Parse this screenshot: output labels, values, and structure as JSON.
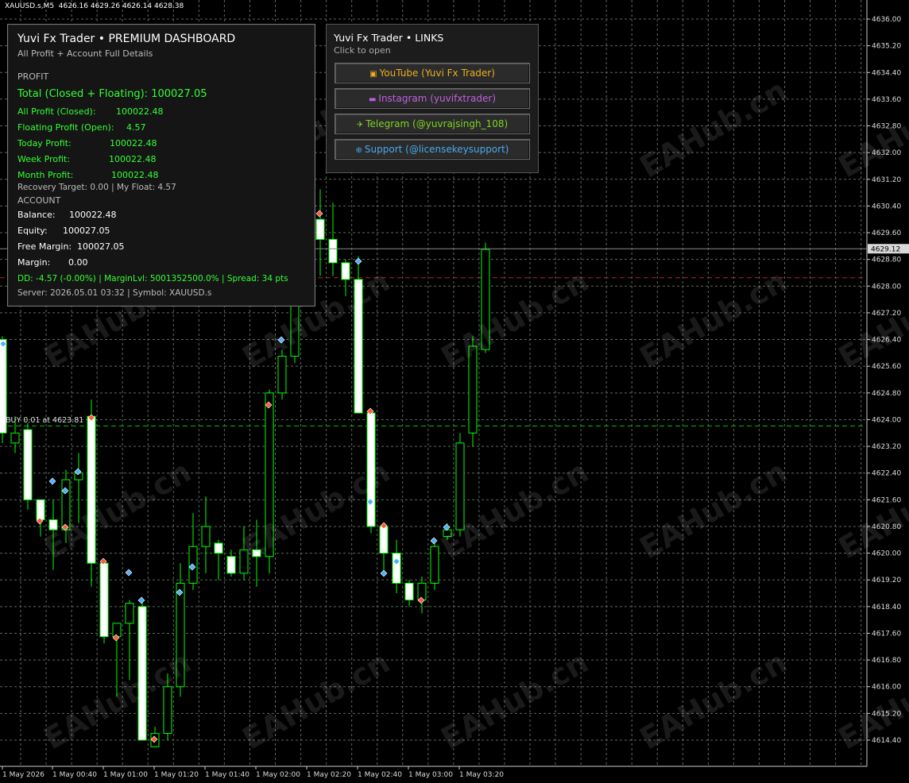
{
  "chart_header": {
    "symbol": "XAUUSD.s,M5",
    "ohlc": "4626.16 4629.26 4626.14 4628.38"
  },
  "dashboard": {
    "title": "Yuvi Fx Trader • PREMIUM DASHBOARD",
    "subtitle": "All Profit + Account Full Details",
    "profit_section": "PROFIT",
    "total_label": "Total (Closed + Floating):",
    "total_value": "100027.05",
    "rows": [
      {
        "label": "All Profit (Closed):",
        "value": "100022.48"
      },
      {
        "label": "Floating Profit (Open):",
        "value": "4.57"
      },
      {
        "label": "Today Profit:",
        "value": "100022.48"
      },
      {
        "label": "Week Profit:",
        "value": "100022.48"
      },
      {
        "label": "Month Profit:",
        "value": "100022.48"
      }
    ],
    "recovery_line": "Recovery Target: 0.00 | My Float: 4.57",
    "account_section": "ACCOUNT",
    "account_rows": [
      {
        "label": "Balance:",
        "value": "100022.48"
      },
      {
        "label": "Equity:",
        "value": "100027.05"
      },
      {
        "label": "Free Margin:",
        "value": "100027.05"
      },
      {
        "label": "Margin:",
        "value": "0.00"
      }
    ],
    "dd_line": "DD: -4.57 (-0.00%) | MarginLvl: 5001352500.0% | Spread: 34 pts",
    "server_line": "Server: 2026.05.01 03:32 | Symbol: XAUUSD.s"
  },
  "links_panel": {
    "title": "Yuvi Fx Trader • LINKS",
    "subtitle": "Click to open",
    "buttons": [
      {
        "icon": "▣",
        "label": "YouTube  (Yuvi Fx Trader)",
        "color": "#e8b020"
      },
      {
        "icon": "▬",
        "label": "Instagram (yuvifxtrader)",
        "color": "#c060e0"
      },
      {
        "icon": "✈",
        "label": "Telegram  (@yuvrajsingh_108)",
        "color": "#7ed321"
      },
      {
        "icon": "⊕",
        "label": "Support  (@licensekeysupport)",
        "color": "#4aa8e8"
      }
    ]
  },
  "buy_label": "BUY 0.01 at 4623.81",
  "current_price": "4629.12",
  "watermark": "EAHub.cn",
  "colors": {
    "background": "#000000",
    "grid": "#5a6a5a",
    "candle_bull_fill": "#000000",
    "candle_bear_fill": "#ffffff",
    "candle_outline": "#00ff00",
    "profit_green": "#33ff33",
    "buy_line": "#00c000",
    "ask_line": "#c02020"
  },
  "chart_data": {
    "type": "candlestick",
    "y_axis_ticks": [
      "4636.00",
      "4635.20",
      "4634.40",
      "4633.60",
      "4632.80",
      "4632.00",
      "4631.20",
      "4630.40",
      "4629.60",
      "4628.80",
      "4628.00",
      "4627.20",
      "4626.40",
      "4625.60",
      "4624.80",
      "4624.00",
      "4623.20",
      "4622.40",
      "4621.60",
      "4620.80",
      "4620.00",
      "4619.20",
      "4618.40",
      "4617.60",
      "4616.80",
      "4616.00",
      "4615.20",
      "4614.40"
    ],
    "x_axis_ticks": [
      "1 May 2026",
      "1 May 00:40",
      "1 May 01:00",
      "1 May 01:20",
      "1 May 01:40",
      "1 May 02:00",
      "1 May 02:20",
      "1 May 02:40",
      "1 May 03:00",
      "1 May 03:20"
    ],
    "ylim": [
      4613.8,
      4636.5
    ],
    "buy_price": 4623.81,
    "ask_price": 4628.25,
    "candles": [
      {
        "o": 4626.4,
        "h": 4626.5,
        "l": 4623.3,
        "c": 4623.6
      },
      {
        "o": 4623.3,
        "h": 4624.1,
        "l": 4623.0,
        "c": 4623.6
      },
      {
        "o": 4623.7,
        "h": 4623.9,
        "l": 4621.3,
        "c": 4621.6
      },
      {
        "o": 4621.6,
        "h": 4621.6,
        "l": 4620.5,
        "c": 4621.0
      },
      {
        "o": 4621.0,
        "h": 4621.6,
        "l": 4619.5,
        "c": 4620.7
      },
      {
        "o": 4620.7,
        "h": 4622.5,
        "l": 4620.3,
        "c": 4622.2
      },
      {
        "o": 4622.2,
        "h": 4623.0,
        "l": 4620.9,
        "c": 4622.4
      },
      {
        "o": 4624.1,
        "h": 4624.6,
        "l": 4619.0,
        "c": 4619.7
      },
      {
        "o": 4619.7,
        "h": 4619.8,
        "l": 4617.3,
        "c": 4617.5
      },
      {
        "o": 4617.5,
        "h": 4617.9,
        "l": 4615.7,
        "c": 4617.9
      },
      {
        "o": 4617.9,
        "h": 4618.6,
        "l": 4616.2,
        "c": 4618.5
      },
      {
        "o": 4618.4,
        "h": 4618.6,
        "l": 4614.4,
        "c": 4614.4
      },
      {
        "o": 4614.2,
        "h": 4614.8,
        "l": 4614.2,
        "c": 4614.6
      },
      {
        "o": 4614.6,
        "h": 4616.4,
        "l": 4614.4,
        "c": 4616.0
      },
      {
        "o": 4616.0,
        "h": 4619.7,
        "l": 4615.7,
        "c": 4619.1
      },
      {
        "o": 4619.1,
        "h": 4621.2,
        "l": 4618.9,
        "c": 4620.2
      },
      {
        "o": 4620.2,
        "h": 4621.7,
        "l": 4619.4,
        "c": 4620.8
      },
      {
        "o": 4620.3,
        "h": 4620.4,
        "l": 4619.2,
        "c": 4620.0
      },
      {
        "o": 4619.9,
        "h": 4620.1,
        "l": 4619.3,
        "c": 4619.4
      },
      {
        "o": 4619.4,
        "h": 4620.8,
        "l": 4619.2,
        "c": 4620.1
      },
      {
        "o": 4620.1,
        "h": 4621.0,
        "l": 4619.0,
        "c": 4619.9
      },
      {
        "o": 4619.9,
        "h": 4624.9,
        "l": 4619.4,
        "c": 4624.8
      },
      {
        "o": 4624.8,
        "h": 4626.1,
        "l": 4624.6,
        "c": 4625.9
      },
      {
        "o": 4625.9,
        "h": 4628.5,
        "l": 4625.7,
        "c": 4628.2
      },
      {
        "o": 4628.2,
        "h": 4630.6,
        "l": 4628.0,
        "c": 4630.0
      },
      {
        "o": 4630.0,
        "h": 4630.9,
        "l": 4628.3,
        "c": 4629.4
      },
      {
        "o": 4629.4,
        "h": 4630.5,
        "l": 4628.3,
        "c": 4628.7
      },
      {
        "o": 4628.7,
        "h": 4628.8,
        "l": 4627.7,
        "c": 4628.2
      },
      {
        "o": 4628.2,
        "h": 4628.9,
        "l": 4624.2,
        "c": 4624.2
      },
      {
        "o": 4624.2,
        "h": 4624.3,
        "l": 4620.6,
        "c": 4620.8
      },
      {
        "o": 4620.8,
        "h": 4620.9,
        "l": 4619.3,
        "c": 4620.0
      },
      {
        "o": 4620.0,
        "h": 4620.4,
        "l": 4618.8,
        "c": 4619.1
      },
      {
        "o": 4619.1,
        "h": 4619.2,
        "l": 4618.4,
        "c": 4618.6
      },
      {
        "o": 4618.6,
        "h": 4619.3,
        "l": 4618.2,
        "c": 4619.1
      },
      {
        "o": 4619.1,
        "h": 4620.4,
        "l": 4618.9,
        "c": 4620.2
      },
      {
        "o": 4620.5,
        "h": 4620.9,
        "l": 4620.4,
        "c": 4620.7
      },
      {
        "o": 4620.7,
        "h": 4623.6,
        "l": 4620.5,
        "c": 4623.3
      },
      {
        "o": 4623.6,
        "h": 4626.5,
        "l": 4623.2,
        "c": 4626.2
      },
      {
        "o": 4626.1,
        "h": 4629.3,
        "l": 4626.0,
        "c": 4629.1
      }
    ]
  }
}
